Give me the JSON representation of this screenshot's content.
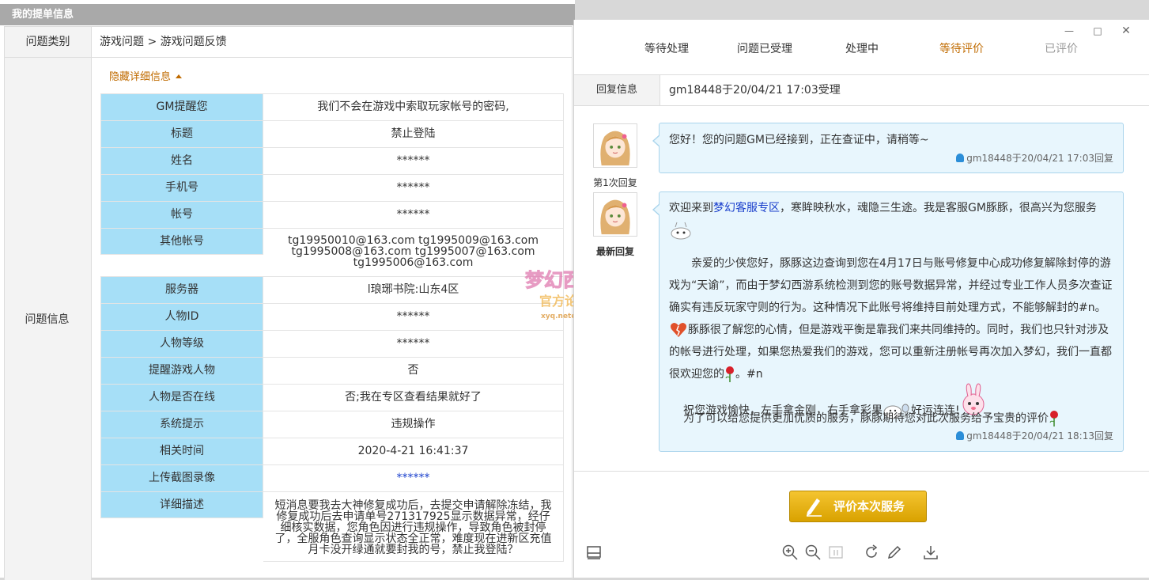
{
  "left": {
    "title": "我的提单信息",
    "category_label": "问题类别",
    "category_value": "游戏问题 > 游戏问题反馈",
    "info_label": "问题信息",
    "toggle_label": "隐藏详细信息",
    "rows": [
      {
        "label": "GM提醒您",
        "value": "我们不会在游戏中索取玩家帐号的密码,"
      },
      {
        "label": "标题",
        "value": "禁止登陆"
      },
      {
        "label": "姓名",
        "value": "******"
      },
      {
        "label": "手机号",
        "value": "******"
      },
      {
        "label": "帐号",
        "value": "******"
      },
      {
        "label": "其他帐号",
        "value": "tg19950010@163.com tg1995009@163.com tg1995008@163.com tg1995007@163.com tg1995006@163.com"
      },
      {
        "label": "服务器",
        "value": "l琅琊书院:山东4区"
      },
      {
        "label": "人物ID",
        "value": "******"
      },
      {
        "label": "人物等级",
        "value": "******"
      },
      {
        "label": "提醒游戏人物",
        "value": "否"
      },
      {
        "label": "人物是否在线",
        "value": "否;我在专区查看结果就好了"
      },
      {
        "label": "系统提示",
        "value": "违规操作"
      },
      {
        "label": "相关时间",
        "value": "2020-4-21 16:41:37"
      },
      {
        "label": "上传截图录像",
        "value": "******"
      },
      {
        "label": "详细描述",
        "value": "短消息要我去大神修复成功后，去提交申请解除冻结，我修复成功后去申请单号271317925显示数据异常，经仔细核实数据，您角色因进行违规操作，导致角色被封停了，全服角色查询显示状态全正常，难度现在进新区充值月卡没开绿通就要封我的号，禁止我登陆？"
      }
    ]
  },
  "right": {
    "steps": [
      "等待处理",
      "问题已受理",
      "处理中",
      "等待评价",
      "已评价"
    ],
    "active_step": "等待评价",
    "reply_label": "回复信息",
    "reply_text": "gm18448于20/04/21 17:03受理",
    "reply1": {
      "caption": "第1次回复",
      "text": "您好！您的问题GM已经接到，正在查证中，请稍等~",
      "sig": "gm18448于20/04/21 17:03回复"
    },
    "reply2": {
      "caption": "最新回复",
      "p1_pre": "欢迎来到",
      "p1_link": "梦幻客服专区",
      "p1_post": "，寒眸映秋水，魂隐三生途。我是客服GM豚豚，很高兴为您服务",
      "p2": "亲爱的少侠您好，豚豚这边查询到您在4月17日与账号修复中心成功修复解除封停的游戏为“天谕”，而由于梦幻西游系统检测到您的账号数据异常，并经过专业工作人员多次查证确实有违反玩家守则的行为。这种情况下此账号将维持目前处理方式，不能够解封的#n。",
      "p2b": "豚豚很了解您的心情，但是游戏平衡是靠我们来共同维持的。同时，我们也只针对涉及的帐号进行处理，如果您热爱我们的游戏，您可以重新注册帐号再次加入梦幻，我们一直都很欢迎您的",
      "p2c": "。#n",
      "p3a": "祝您游戏愉快，左手拿金刚，右手拿彩果",
      "p3b": "好运连连!",
      "p4": "为了可以给您提供更加优质的服务，豚豚期待您对此次服务给予宝贵的评价",
      "sig": "gm18448于20/04/21 18:13回复"
    },
    "rate_button": "评价本次服务"
  },
  "colors": {
    "label_bg": "#a6dff7",
    "accent": "#c06b00",
    "bubble_bg": "#e8f6fd",
    "button": "#e0ab10",
    "link": "#1a3fcc"
  }
}
